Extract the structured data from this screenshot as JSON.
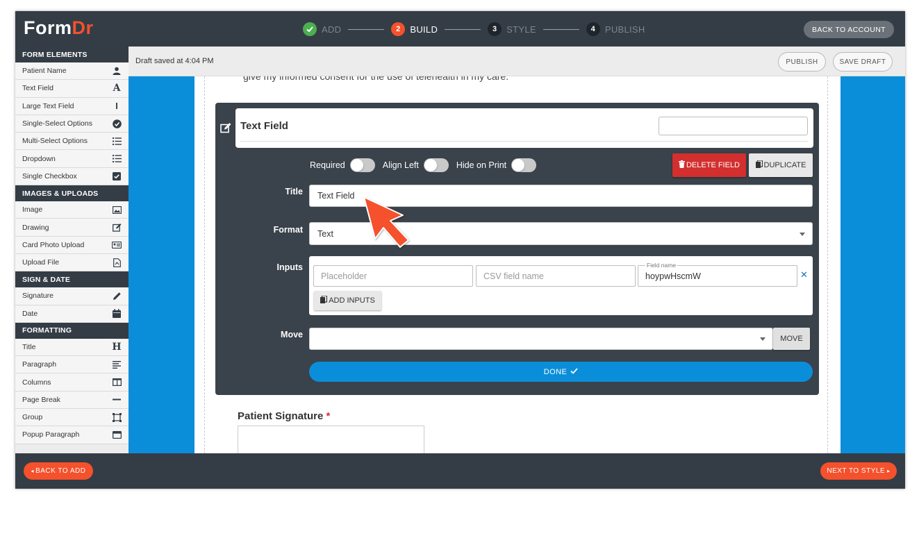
{
  "app": {
    "logo_main": "Form",
    "logo_accent": "Dr",
    "back_to_account": "BACK TO ACCOUNT"
  },
  "steps": [
    {
      "num": "",
      "label": "ADD",
      "state": "done"
    },
    {
      "num": "2",
      "label": "BUILD",
      "state": "active"
    },
    {
      "num": "3",
      "label": "STYLE",
      "state": "pending"
    },
    {
      "num": "4",
      "label": "PUBLISH",
      "state": "pending"
    }
  ],
  "sidebar": {
    "form_elements_header": "FORM ELEMENTS",
    "form_elements": [
      {
        "label": "Patient Name",
        "icon": "person-icon"
      },
      {
        "label": "Text Field",
        "icon": "letter-a-icon"
      },
      {
        "label": "Large Text Field",
        "icon": "text-cursor-icon"
      },
      {
        "label": "Single-Select Options",
        "icon": "check-circle-icon"
      },
      {
        "label": "Multi-Select Options",
        "icon": "list-icon"
      },
      {
        "label": "Dropdown",
        "icon": "list-icon"
      },
      {
        "label": "Single Checkbox",
        "icon": "checkbox-icon"
      }
    ],
    "images_header": "IMAGES & UPLOADS",
    "images": [
      {
        "label": "Image",
        "icon": "image-icon"
      },
      {
        "label": "Drawing",
        "icon": "edit-icon"
      },
      {
        "label": "Card Photo Upload",
        "icon": "id-card-icon"
      },
      {
        "label": "Upload File",
        "icon": "file-icon"
      }
    ],
    "sign_header": "SIGN & DATE",
    "sign": [
      {
        "label": "Signature",
        "icon": "pen-icon"
      },
      {
        "label": "Date",
        "icon": "calendar-icon"
      }
    ],
    "formatting_header": "FORMATTING",
    "formatting": [
      {
        "label": "Title",
        "icon": "heading-icon"
      },
      {
        "label": "Paragraph",
        "icon": "paragraph-icon"
      },
      {
        "label": "Columns",
        "icon": "columns-icon"
      },
      {
        "label": "Page Break",
        "icon": "minus-icon"
      },
      {
        "label": "Group",
        "icon": "group-icon"
      },
      {
        "label": "Popup Paragraph",
        "icon": "window-icon"
      }
    ]
  },
  "subbar": {
    "status": "Draft saved at 4:04 PM",
    "publish": "PUBLISH",
    "save_draft": "SAVE DRAFT"
  },
  "canvas": {
    "consent_text": "give my informed consent for the use of telehealth in my care.",
    "signature_label": "Patient Signature",
    "required_mark": "*"
  },
  "editor": {
    "card_title": "Text Field",
    "card_input_value": "",
    "required_label": "Required",
    "align_left_label": "Align Left",
    "hide_on_print_label": "Hide on Print",
    "delete_label": "DELETE FIELD",
    "duplicate_label": "DUPLICATE",
    "title_label": "Title",
    "title_value": "Text Field",
    "format_label": "Format",
    "format_value": "Text",
    "inputs_label": "Inputs",
    "placeholder_hint": "Placeholder",
    "csv_hint": "CSV field name",
    "field_name_caption": "Field name",
    "field_name_value": "hoypwHscmW",
    "add_inputs_label": "ADD INPUTS",
    "move_label": "Move",
    "move_value": "",
    "move_button": "MOVE",
    "done_label": "DONE"
  },
  "bottombar": {
    "back_to_add": "BACK TO ADD",
    "next_to_style": "NEXT TO STYLE"
  },
  "colors": {
    "brand_orange": "#f4512c",
    "dark_bar": "#343d46",
    "canvas_blue": "#0b8ed9",
    "delete_red": "#d32f2f",
    "step_done_green": "#4caf50"
  }
}
